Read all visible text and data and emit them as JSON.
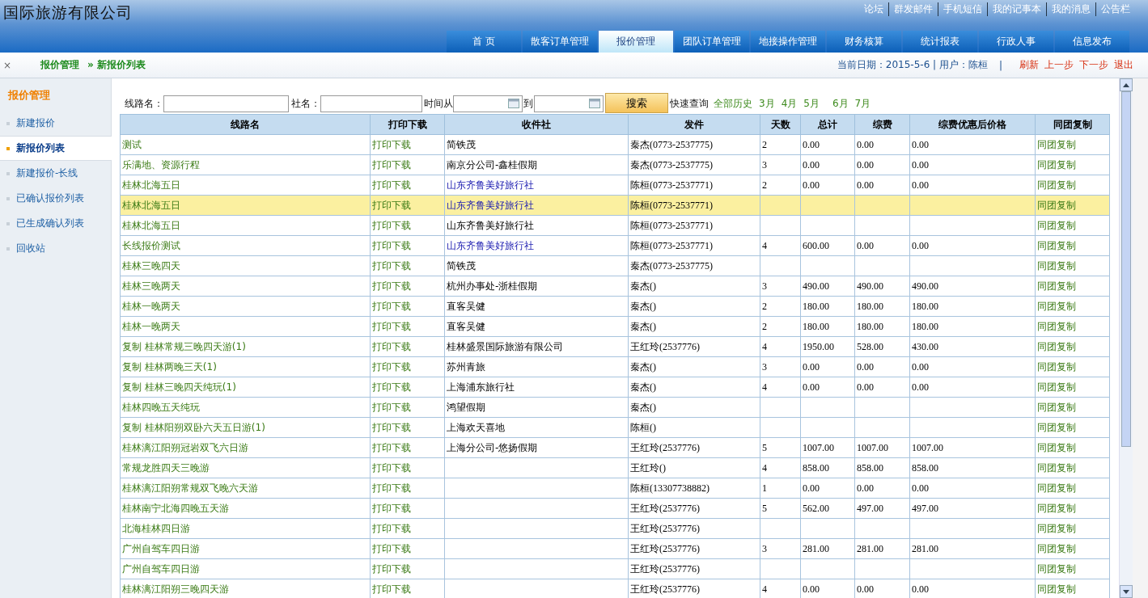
{
  "header": {
    "title": "国际旅游有限公司",
    "top_links": [
      "论坛",
      "群发邮件",
      "手机短信",
      "我的记事本",
      "我的消息",
      "公告栏"
    ],
    "tabs": [
      {
        "label": "首 页",
        "selected": false
      },
      {
        "label": "散客订单管理",
        "selected": false
      },
      {
        "label": "报价管理",
        "selected": true
      },
      {
        "label": "团队订单管理",
        "selected": false
      },
      {
        "label": "地接操作管理",
        "selected": false
      },
      {
        "label": "财务核算",
        "selected": false
      },
      {
        "label": "统计报表",
        "selected": false
      },
      {
        "label": "行政人事",
        "selected": false
      },
      {
        "label": "信息发布",
        "selected": false
      }
    ]
  },
  "breadcrumb": {
    "close": "×",
    "section": "报价管理",
    "page": "» 新报价列表",
    "info": "当前日期：2015-5-6 | 用户：陈桓",
    "separator": "|",
    "actions": [
      "刷新",
      "上一步",
      "下一步",
      "退出"
    ]
  },
  "sidebar": {
    "title": "报价管理",
    "items": [
      {
        "label": "新建报价",
        "selected": false
      },
      {
        "label": "新报价列表",
        "selected": true
      },
      {
        "label": "新建报价-长线",
        "selected": false
      },
      {
        "label": "已确认报价列表",
        "selected": false
      },
      {
        "label": "已生成确认列表",
        "selected": false
      },
      {
        "label": "回收站",
        "selected": false
      }
    ]
  },
  "search": {
    "route_label": "线路名：",
    "agency_label": "社名：",
    "from_label": "时间从",
    "to_label": "到",
    "button": "搜索",
    "quick_label": "快速查询",
    "quick_links": [
      "全部历史",
      "3月",
      "4月",
      "5月",
      "6月",
      "7月"
    ]
  },
  "table": {
    "columns": [
      "线路名",
      "打印下载",
      "收件社",
      "发件",
      "天数",
      "总计",
      "综费",
      "综费优惠后价格",
      "同团复制"
    ],
    "rows": [
      {
        "name": "测试",
        "print": "打印下载",
        "receiver": "简铁茂",
        "receiver_link": false,
        "sender": "秦杰(0773-2537775)",
        "days": "2",
        "total": "0.00",
        "fee": "0.00",
        "net": "0.00",
        "copy": "同团复制",
        "selected": false
      },
      {
        "name": "乐满地、资源行程",
        "print": "打印下载",
        "receiver": "南京分公司-鑫桂假期",
        "receiver_link": false,
        "sender": "秦杰(0773-2537775)",
        "days": "3",
        "total": "0.00",
        "fee": "0.00",
        "net": "0.00",
        "copy": "同团复制",
        "selected": false
      },
      {
        "name": "桂林北海五日",
        "print": "打印下载",
        "receiver": "山东齐鲁美好旅行社",
        "receiver_link": true,
        "sender": "陈桓(0773-2537771)",
        "days": "2",
        "total": "0.00",
        "fee": "0.00",
        "net": "0.00",
        "copy": "同团复制",
        "selected": false
      },
      {
        "name": "桂林北海五日",
        "print": "打印下载",
        "receiver": "山东齐鲁美好旅行社",
        "receiver_link": true,
        "sender": "陈桓(0773-2537771)",
        "copy": "同团复制",
        "selected": true
      },
      {
        "name": "桂林北海五日",
        "print": "打印下载",
        "receiver": "山东齐鲁美好旅行社",
        "receiver_link": false,
        "sender": "陈桓(0773-2537771)",
        "copy": "同团复制",
        "selected": false
      },
      {
        "name": "长线报价测试",
        "print": "打印下载",
        "receiver": "山东齐鲁美好旅行社",
        "receiver_link": true,
        "sender": "陈桓(0773-2537771)",
        "days": "4",
        "total": "600.00",
        "fee": "0.00",
        "net": "0.00",
        "copy": "同团复制",
        "selected": false
      },
      {
        "name": "桂林三晚四天",
        "print": "打印下载",
        "receiver": "简铁茂",
        "receiver_link": false,
        "sender": "秦杰(0773-2537775)",
        "copy": "同团复制",
        "selected": false
      },
      {
        "name": "桂林三晚两天",
        "print": "打印下载",
        "receiver": "杭州办事处-浙桂假期",
        "receiver_link": false,
        "sender": "秦杰()",
        "days": "3",
        "total": "490.00",
        "fee": "490.00",
        "net": "490.00",
        "copy": "同团复制",
        "selected": false
      },
      {
        "name": "桂林一晚两天",
        "print": "打印下载",
        "receiver": "直客吴健",
        "receiver_link": false,
        "sender": "秦杰()",
        "days": "2",
        "total": "180.00",
        "fee": "180.00",
        "net": "180.00",
        "copy": "同团复制",
        "selected": false
      },
      {
        "name": "桂林一晚两天",
        "print": "打印下载",
        "receiver": "直客吴健",
        "receiver_link": false,
        "sender": "秦杰()",
        "days": "2",
        "total": "180.00",
        "fee": "180.00",
        "net": "180.00",
        "copy": "同团复制",
        "selected": false
      },
      {
        "name": "复制 桂林常规三晚四天游(1)",
        "print": "打印下载",
        "receiver": "桂林盛景国际旅游有限公司",
        "receiver_link": false,
        "sender": "王红玲(2537776)",
        "days": "4",
        "total": "1950.00",
        "fee": "528.00",
        "net": "430.00",
        "copy": "同团复制",
        "selected": false
      },
      {
        "name": "复制 桂林两晚三天(1)",
        "print": "打印下载",
        "receiver": "苏州青旅",
        "receiver_link": false,
        "sender": "秦杰()",
        "days": "3",
        "total": "0.00",
        "fee": "0.00",
        "net": "0.00",
        "copy": "同团复制",
        "selected": false
      },
      {
        "name": "复制 桂林三晚四天纯玩(1)",
        "print": "打印下载",
        "receiver": "上海浦东旅行社",
        "receiver_link": false,
        "sender": "秦杰()",
        "days": "4",
        "total": "0.00",
        "fee": "0.00",
        "net": "0.00",
        "copy": "同团复制",
        "selected": false
      },
      {
        "name": "桂林四晚五天纯玩",
        "print": "打印下载",
        "receiver": "鸿望假期",
        "receiver_link": false,
        "sender": "秦杰()",
        "copy": "同团复制",
        "selected": false
      },
      {
        "name": "复制 桂林阳朔双卧六天五日游(1)",
        "print": "打印下载",
        "receiver": "上海欢天喜地",
        "receiver_link": false,
        "sender": "陈桓()",
        "copy": "同团复制",
        "selected": false
      },
      {
        "name": "桂林漓江阳朔冠岩双飞六日游",
        "print": "打印下载",
        "receiver": "上海分公司-悠扬假期",
        "receiver_link": false,
        "sender": "王红玲(2537776)",
        "days": "5",
        "total": "1007.00",
        "fee": "1007.00",
        "net": "1007.00",
        "copy": "同团复制",
        "selected": false
      },
      {
        "name": "常规龙胜四天三晚游",
        "print": "打印下载",
        "sender": "王红玲()",
        "days": "4",
        "total": "858.00",
        "fee": "858.00",
        "net": "858.00",
        "copy": "同团复制",
        "selected": false
      },
      {
        "name": "桂林漓江阳朔常规双飞晚六天游",
        "print": "打印下载",
        "sender": "陈桓(13307738882)",
        "days": "1",
        "total": "0.00",
        "fee": "0.00",
        "net": "0.00",
        "copy": "同团复制",
        "selected": false
      },
      {
        "name": "桂林南宁北海四晚五天游",
        "print": "打印下载",
        "sender": "王红玲(2537776)",
        "days": "5",
        "total": "562.00",
        "fee": "497.00",
        "net": "497.00",
        "copy": "同团复制",
        "selected": false
      },
      {
        "name": "北海桂林四日游",
        "print": "打印下载",
        "sender": "王红玲(2537776)",
        "copy": "同团复制",
        "selected": false
      },
      {
        "name": "广州自驾车四日游",
        "print": "打印下载",
        "sender": "王红玲(2537776)",
        "days": "3",
        "total": "281.00",
        "fee": "281.00",
        "net": "281.00",
        "copy": "同团复制",
        "selected": false
      },
      {
        "name": "广州自驾车四日游",
        "print": "打印下载",
        "sender": "王红玲(2537776)",
        "copy": "同团复制",
        "selected": false
      },
      {
        "name": "桂林漓江阳朔三晚四天游",
        "print": "打印下载",
        "sender": "王红玲(2537776)",
        "days": "4",
        "total": "0.00",
        "fee": "0.00",
        "net": "0.00",
        "copy": "同团复制",
        "selected": false
      }
    ]
  }
}
